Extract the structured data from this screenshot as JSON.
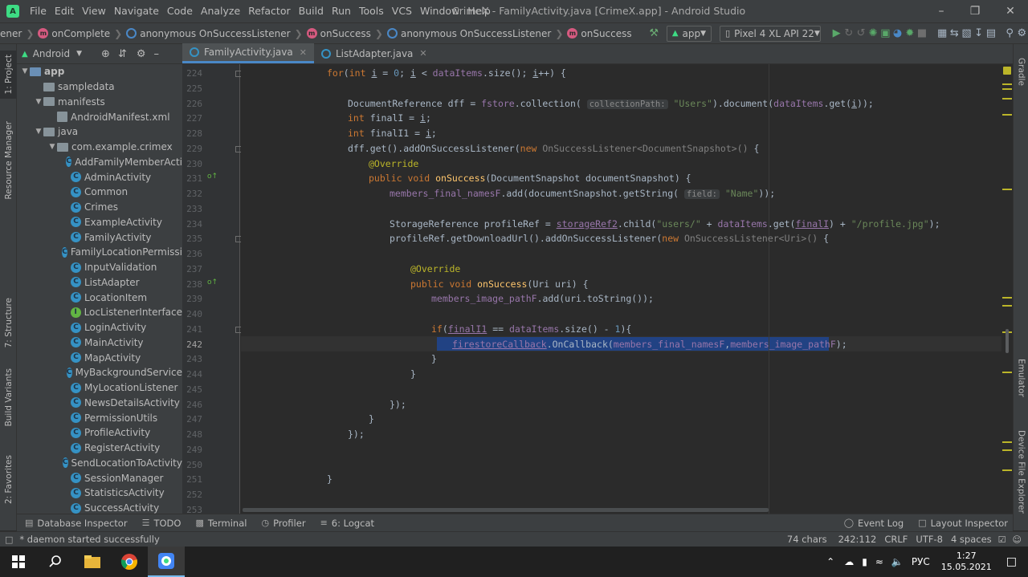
{
  "menu": {
    "items": [
      "File",
      "Edit",
      "View",
      "Navigate",
      "Code",
      "Analyze",
      "Refactor",
      "Build",
      "Run",
      "Tools",
      "VCS",
      "Window",
      "Help"
    ],
    "window_title": "CrimeX - FamilyActivity.java [CrimeX.app] - Android Studio"
  },
  "navbar": {
    "breadcrumbs": [
      "ener",
      "onComplete",
      "anonymous OnSuccessListener",
      "onSuccess",
      "anonymous OnSuccessListener",
      "onSuccess"
    ],
    "run_config": "app",
    "device": "Pixel 4 XL API 22"
  },
  "left_strip": {
    "tabs": [
      "1: Project",
      "Resource Manager",
      "7: Structure",
      "Build Variants",
      "2: Favorites"
    ]
  },
  "right_strip": {
    "tabs": [
      "Gradle",
      "Emulator",
      "Device File Explorer"
    ]
  },
  "project": {
    "view_mode": "Android",
    "tree": [
      {
        "label": "app",
        "type": "module",
        "expanded": true,
        "bold": true
      },
      {
        "label": "sampledata",
        "type": "folder"
      },
      {
        "label": "manifests",
        "type": "folder",
        "expanded": true
      },
      {
        "label": "AndroidManifest.xml",
        "type": "xml"
      },
      {
        "label": "java",
        "type": "folder",
        "expanded": true
      },
      {
        "label": "com.example.crimex",
        "type": "package",
        "expanded": true
      },
      {
        "label": "AddFamilyMemberActi",
        "type": "class"
      },
      {
        "label": "AdminActivity",
        "type": "class"
      },
      {
        "label": "Common",
        "type": "class"
      },
      {
        "label": "Crimes",
        "type": "class"
      },
      {
        "label": "ExampleActivity",
        "type": "class"
      },
      {
        "label": "FamilyActivity",
        "type": "class"
      },
      {
        "label": "FamilyLocationPermissi",
        "type": "class"
      },
      {
        "label": "InputValidation",
        "type": "class"
      },
      {
        "label": "ListAdapter",
        "type": "class"
      },
      {
        "label": "LocationItem",
        "type": "class"
      },
      {
        "label": "LocListenerInterface",
        "type": "interface"
      },
      {
        "label": "LoginActivity",
        "type": "class"
      },
      {
        "label": "MainActivity",
        "type": "class"
      },
      {
        "label": "MapActivity",
        "type": "class"
      },
      {
        "label": "MyBackgroundService",
        "type": "class"
      },
      {
        "label": "MyLocationListener",
        "type": "class"
      },
      {
        "label": "NewsDetailsActivity",
        "type": "class"
      },
      {
        "label": "PermissionUtils",
        "type": "class"
      },
      {
        "label": "ProfileActivity",
        "type": "class"
      },
      {
        "label": "RegisterActivity",
        "type": "class"
      },
      {
        "label": "SendLocationToActivity",
        "type": "class"
      },
      {
        "label": "SessionManager",
        "type": "class"
      },
      {
        "label": "StatisticsActivity",
        "type": "class"
      },
      {
        "label": "SuccessActivity",
        "type": "class"
      }
    ]
  },
  "editor": {
    "tabs": [
      {
        "label": "FamilyActivity.java",
        "active": true
      },
      {
        "label": "ListAdapter.java",
        "active": false
      }
    ],
    "line_numbers": [
      "224",
      "225",
      "226",
      "227",
      "228",
      "229",
      "230",
      "231",
      "232",
      "233",
      "234",
      "235",
      "236",
      "237",
      "238",
      "239",
      "240",
      "241",
      "242",
      "243",
      "244",
      "245",
      "246",
      "247",
      "248",
      "249",
      "250",
      "251",
      "252",
      "253"
    ],
    "current_line": "242"
  },
  "bottom_tabs": [
    "Database Inspector",
    "TODO",
    "Terminal",
    "Profiler",
    "6: Logcat",
    "Event Log",
    "Layout Inspector"
  ],
  "status": {
    "message": "* daemon started successfully",
    "chars": "74 chars",
    "position": "242:112",
    "line_sep": "CRLF",
    "encoding": "UTF-8",
    "indent": "4 spaces"
  },
  "taskbar": {
    "lang": "РУС",
    "time": "1:27",
    "date": "15.05.2021"
  }
}
